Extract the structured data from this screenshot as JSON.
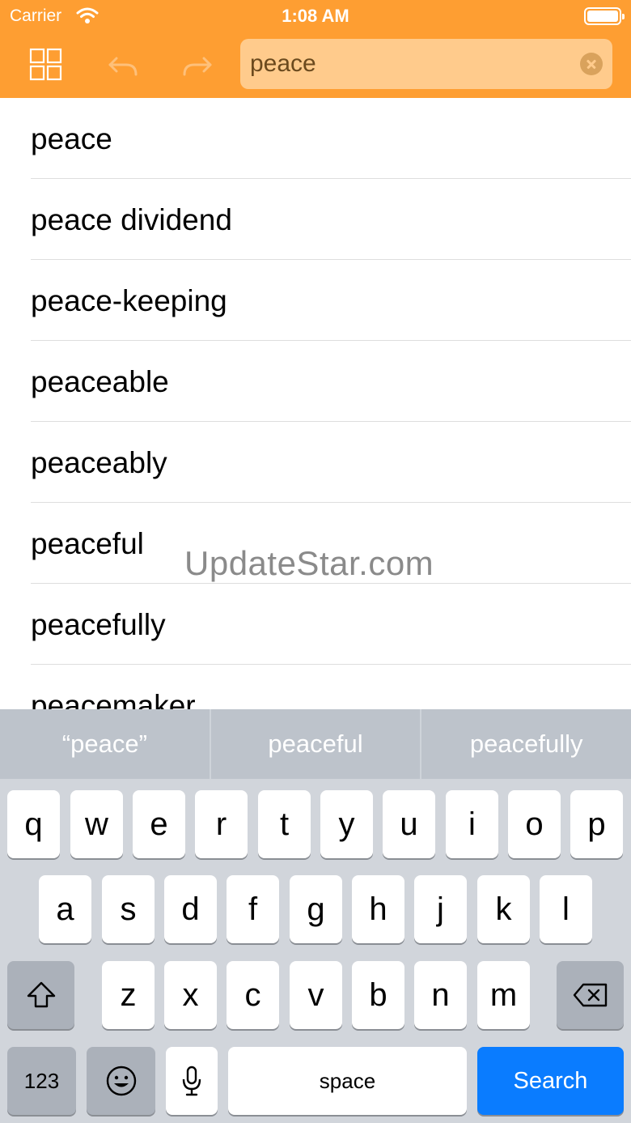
{
  "status_bar": {
    "carrier": "Carrier",
    "time": "1:08 AM"
  },
  "nav": {
    "search_value": "peace",
    "icons": [
      "grid-icon",
      "undo-icon",
      "redo-icon",
      "clear-icon"
    ]
  },
  "results": [
    "peace",
    "peace dividend",
    "peace-keeping",
    "peaceable",
    "peaceably",
    "peaceful",
    "peacefully",
    "peacemaker"
  ],
  "watermark": "UpdateStar.com",
  "predictive": [
    "“peace”",
    "peaceful",
    "peacefully"
  ],
  "keyboard": {
    "row1": [
      "q",
      "w",
      "e",
      "r",
      "t",
      "y",
      "u",
      "i",
      "o",
      "p"
    ],
    "row2": [
      "a",
      "s",
      "d",
      "f",
      "g",
      "h",
      "j",
      "k",
      "l"
    ],
    "row3": [
      "z",
      "x",
      "c",
      "v",
      "b",
      "n",
      "m"
    ],
    "numbers_label": "123",
    "space_label": "space",
    "search_label": "Search"
  },
  "colors": {
    "nav_background": "#fe9e32",
    "search_field": "#ffcb8c",
    "search_key": "#0a7cff"
  }
}
